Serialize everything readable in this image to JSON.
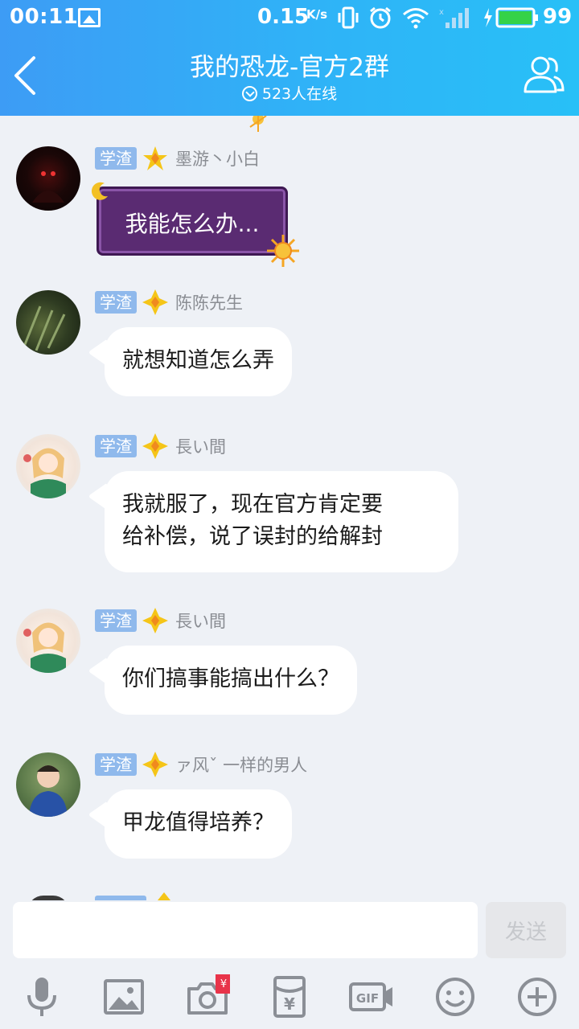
{
  "status_bar": {
    "time": "00:11",
    "speed": "0.15",
    "speed_unit": "K/s",
    "battery": "99"
  },
  "header": {
    "title": "我的恐龙-官方2群",
    "online": "523人在线"
  },
  "messages": [
    {
      "badge": "学渣",
      "nickname": "墨游丶小白",
      "text": "我能怎么办...",
      "style": "fancy"
    },
    {
      "badge": "学渣",
      "nickname": "陈陈先生",
      "text": "就想知道怎么弄"
    },
    {
      "badge": "学渣",
      "nickname": "長い間",
      "lines": [
        "我就服了，现在官方肯定要",
        "给补偿，说了误封的给解封"
      ]
    },
    {
      "badge": "学渣",
      "nickname": "長い間",
      "text": "你们搞事能搞出什么？"
    },
    {
      "badge": "学渣",
      "nickname": "ァ风ˇ  一样的男人",
      "text": "甲龙值得培养？"
    }
  ],
  "composer": {
    "input_value": "",
    "send_label": "发送"
  },
  "toolbar": {
    "items": [
      "microphone-icon",
      "image-icon",
      "camera-icon",
      "red-packet-icon",
      "gif-icon",
      "emoji-icon",
      "plus-icon"
    ]
  },
  "colors": {
    "header_start": "#3d9cf5",
    "header_end": "#28c0f7",
    "badge": "#8fb9ec",
    "star": "#f5c518",
    "background": "#eef1f6"
  }
}
